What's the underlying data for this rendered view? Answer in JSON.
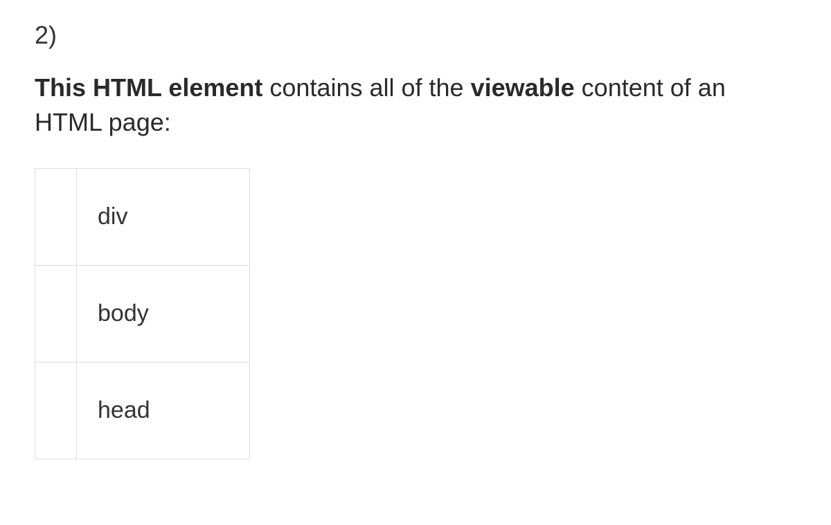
{
  "question": {
    "number": "2)",
    "text_parts": {
      "bold1": "This HTML element",
      "mid1": " contains all of the ",
      "bold2": "viewable",
      "mid2": " content of an HTML page:"
    },
    "options": [
      {
        "label": "div"
      },
      {
        "label": "body"
      },
      {
        "label": "head"
      }
    ]
  }
}
